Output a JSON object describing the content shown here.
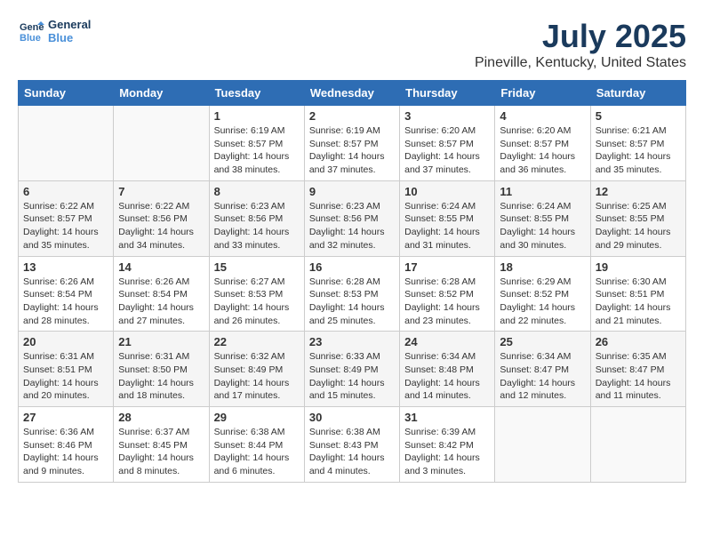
{
  "header": {
    "logo_line1": "General",
    "logo_line2": "Blue",
    "title": "July 2025",
    "subtitle": "Pineville, Kentucky, United States"
  },
  "days_of_week": [
    "Sunday",
    "Monday",
    "Tuesday",
    "Wednesday",
    "Thursday",
    "Friday",
    "Saturday"
  ],
  "weeks": [
    [
      {
        "day": "",
        "info": ""
      },
      {
        "day": "",
        "info": ""
      },
      {
        "day": "1",
        "info": "Sunrise: 6:19 AM\nSunset: 8:57 PM\nDaylight: 14 hours and 38 minutes."
      },
      {
        "day": "2",
        "info": "Sunrise: 6:19 AM\nSunset: 8:57 PM\nDaylight: 14 hours and 37 minutes."
      },
      {
        "day": "3",
        "info": "Sunrise: 6:20 AM\nSunset: 8:57 PM\nDaylight: 14 hours and 37 minutes."
      },
      {
        "day": "4",
        "info": "Sunrise: 6:20 AM\nSunset: 8:57 PM\nDaylight: 14 hours and 36 minutes."
      },
      {
        "day": "5",
        "info": "Sunrise: 6:21 AM\nSunset: 8:57 PM\nDaylight: 14 hours and 35 minutes."
      }
    ],
    [
      {
        "day": "6",
        "info": "Sunrise: 6:22 AM\nSunset: 8:57 PM\nDaylight: 14 hours and 35 minutes."
      },
      {
        "day": "7",
        "info": "Sunrise: 6:22 AM\nSunset: 8:56 PM\nDaylight: 14 hours and 34 minutes."
      },
      {
        "day": "8",
        "info": "Sunrise: 6:23 AM\nSunset: 8:56 PM\nDaylight: 14 hours and 33 minutes."
      },
      {
        "day": "9",
        "info": "Sunrise: 6:23 AM\nSunset: 8:56 PM\nDaylight: 14 hours and 32 minutes."
      },
      {
        "day": "10",
        "info": "Sunrise: 6:24 AM\nSunset: 8:55 PM\nDaylight: 14 hours and 31 minutes."
      },
      {
        "day": "11",
        "info": "Sunrise: 6:24 AM\nSunset: 8:55 PM\nDaylight: 14 hours and 30 minutes."
      },
      {
        "day": "12",
        "info": "Sunrise: 6:25 AM\nSunset: 8:55 PM\nDaylight: 14 hours and 29 minutes."
      }
    ],
    [
      {
        "day": "13",
        "info": "Sunrise: 6:26 AM\nSunset: 8:54 PM\nDaylight: 14 hours and 28 minutes."
      },
      {
        "day": "14",
        "info": "Sunrise: 6:26 AM\nSunset: 8:54 PM\nDaylight: 14 hours and 27 minutes."
      },
      {
        "day": "15",
        "info": "Sunrise: 6:27 AM\nSunset: 8:53 PM\nDaylight: 14 hours and 26 minutes."
      },
      {
        "day": "16",
        "info": "Sunrise: 6:28 AM\nSunset: 8:53 PM\nDaylight: 14 hours and 25 minutes."
      },
      {
        "day": "17",
        "info": "Sunrise: 6:28 AM\nSunset: 8:52 PM\nDaylight: 14 hours and 23 minutes."
      },
      {
        "day": "18",
        "info": "Sunrise: 6:29 AM\nSunset: 8:52 PM\nDaylight: 14 hours and 22 minutes."
      },
      {
        "day": "19",
        "info": "Sunrise: 6:30 AM\nSunset: 8:51 PM\nDaylight: 14 hours and 21 minutes."
      }
    ],
    [
      {
        "day": "20",
        "info": "Sunrise: 6:31 AM\nSunset: 8:51 PM\nDaylight: 14 hours and 20 minutes."
      },
      {
        "day": "21",
        "info": "Sunrise: 6:31 AM\nSunset: 8:50 PM\nDaylight: 14 hours and 18 minutes."
      },
      {
        "day": "22",
        "info": "Sunrise: 6:32 AM\nSunset: 8:49 PM\nDaylight: 14 hours and 17 minutes."
      },
      {
        "day": "23",
        "info": "Sunrise: 6:33 AM\nSunset: 8:49 PM\nDaylight: 14 hours and 15 minutes."
      },
      {
        "day": "24",
        "info": "Sunrise: 6:34 AM\nSunset: 8:48 PM\nDaylight: 14 hours and 14 minutes."
      },
      {
        "day": "25",
        "info": "Sunrise: 6:34 AM\nSunset: 8:47 PM\nDaylight: 14 hours and 12 minutes."
      },
      {
        "day": "26",
        "info": "Sunrise: 6:35 AM\nSunset: 8:47 PM\nDaylight: 14 hours and 11 minutes."
      }
    ],
    [
      {
        "day": "27",
        "info": "Sunrise: 6:36 AM\nSunset: 8:46 PM\nDaylight: 14 hours and 9 minutes."
      },
      {
        "day": "28",
        "info": "Sunrise: 6:37 AM\nSunset: 8:45 PM\nDaylight: 14 hours and 8 minutes."
      },
      {
        "day": "29",
        "info": "Sunrise: 6:38 AM\nSunset: 8:44 PM\nDaylight: 14 hours and 6 minutes."
      },
      {
        "day": "30",
        "info": "Sunrise: 6:38 AM\nSunset: 8:43 PM\nDaylight: 14 hours and 4 minutes."
      },
      {
        "day": "31",
        "info": "Sunrise: 6:39 AM\nSunset: 8:42 PM\nDaylight: 14 hours and 3 minutes."
      },
      {
        "day": "",
        "info": ""
      },
      {
        "day": "",
        "info": ""
      }
    ]
  ]
}
